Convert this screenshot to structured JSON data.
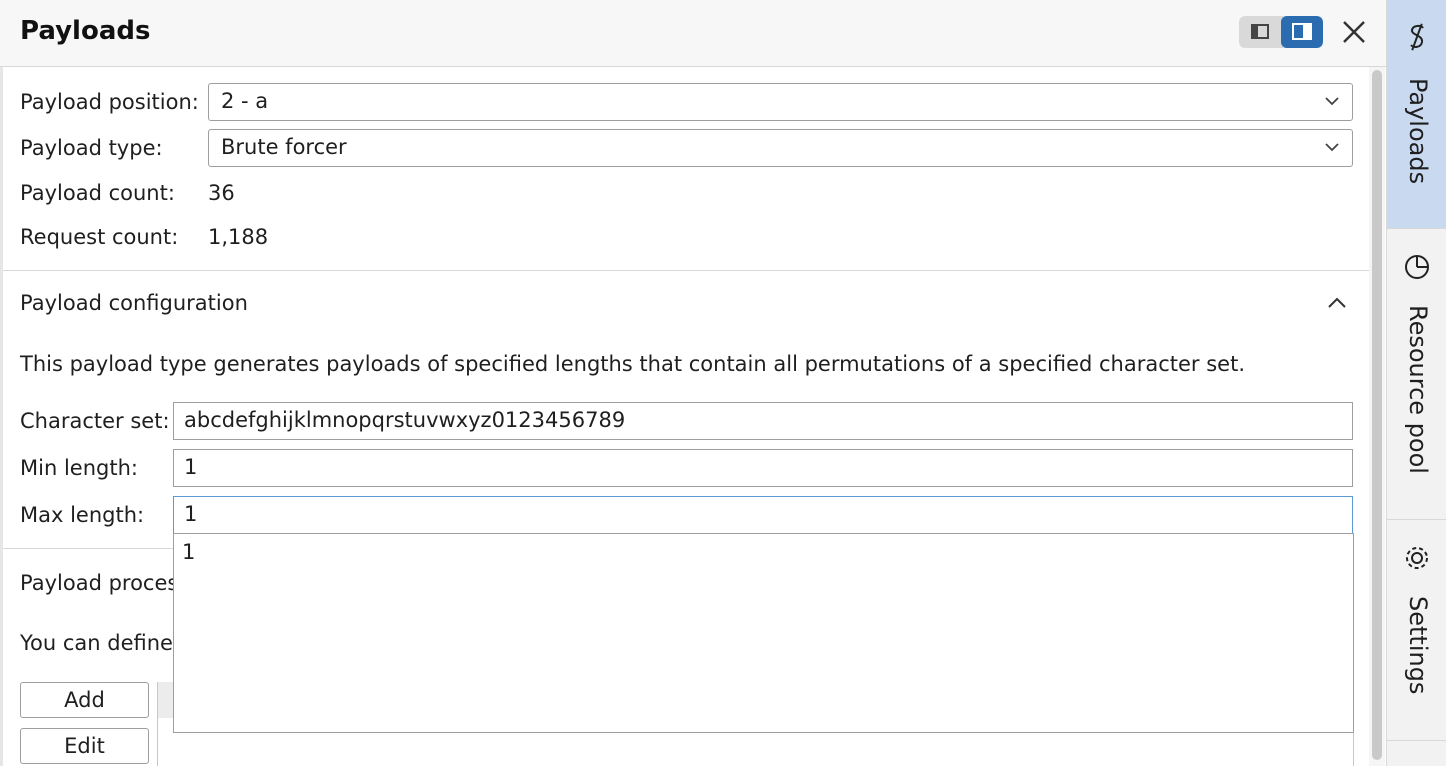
{
  "header": {
    "title": "Payloads"
  },
  "settings": {
    "payload_position": {
      "label": "Payload position:",
      "value": "2 - a"
    },
    "payload_type": {
      "label": "Payload type:",
      "value": "Brute forcer"
    },
    "payload_count": {
      "label": "Payload count:",
      "value": "36"
    },
    "request_count": {
      "label": "Request count:",
      "value": "1,188"
    }
  },
  "configuration": {
    "heading": "Payload configuration",
    "description": "This payload type generates payloads of specified lengths that contain all permutations of a specified character set.",
    "character_set": {
      "label": "Character set:",
      "value": "abcdefghijklmnopqrstuvwxyz0123456789"
    },
    "min_length": {
      "label": "Min length:",
      "value": "1"
    },
    "max_length": {
      "label": "Max length:",
      "value": "1"
    }
  },
  "dropdown": {
    "items": [
      "1"
    ]
  },
  "processing": {
    "heading_partial": "Payload proces",
    "description_partial": "You can define",
    "buttons": {
      "add": "Add",
      "edit": "Edit"
    }
  },
  "tabs": [
    {
      "label": "Payloads",
      "icon": "dollar-icon",
      "active": true
    },
    {
      "label": "Resource pool",
      "icon": "pie-chart-icon",
      "active": false
    },
    {
      "label": "Settings",
      "icon": "gear-icon",
      "active": false
    }
  ],
  "colors": {
    "accent": "#2b6cb0",
    "active_tab": "#c9daf0",
    "focus_border": "#5b9bd5"
  }
}
